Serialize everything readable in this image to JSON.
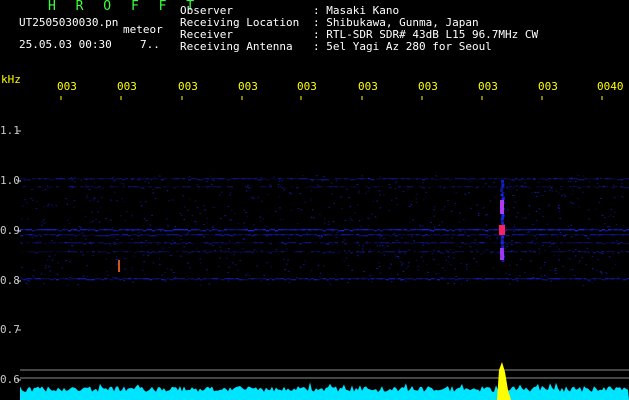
{
  "header": {
    "brand": "H R O F F T",
    "filename": "UT2505030030.pn",
    "mode": "meteor",
    "datetime": "25.05.03 00:30",
    "count": "7.."
  },
  "meta": [
    {
      "label": "Observer",
      "value": ": Masaki Kano"
    },
    {
      "label": "Receiving Location",
      "value": ": Shibukawa, Gunma, Japan"
    },
    {
      "label": "Receiver",
      "value": ": RTL-SDR SDR# 43dB L15 96.7MHz CW"
    },
    {
      "label": "Receiving Antenna",
      "value": ": 5el Yagi Az 280 for Seoul"
    }
  ],
  "axis": {
    "yunit": "kHz",
    "yticks": [
      "1.1",
      "1.0",
      "0.9",
      "0.8",
      "0.7",
      "0.6"
    ],
    "xticks": [
      "003",
      "003",
      "003",
      "003",
      "003",
      "003",
      "003",
      "003",
      "003",
      "0040"
    ]
  },
  "colors": {
    "background": "#000000",
    "brand": "#3cff3c",
    "tick_x": "#ffff00",
    "signal_low": "#1a2aff",
    "signal_high": "#ff2060",
    "baseline": "#00e5ff",
    "burst": "#ffff00"
  }
}
